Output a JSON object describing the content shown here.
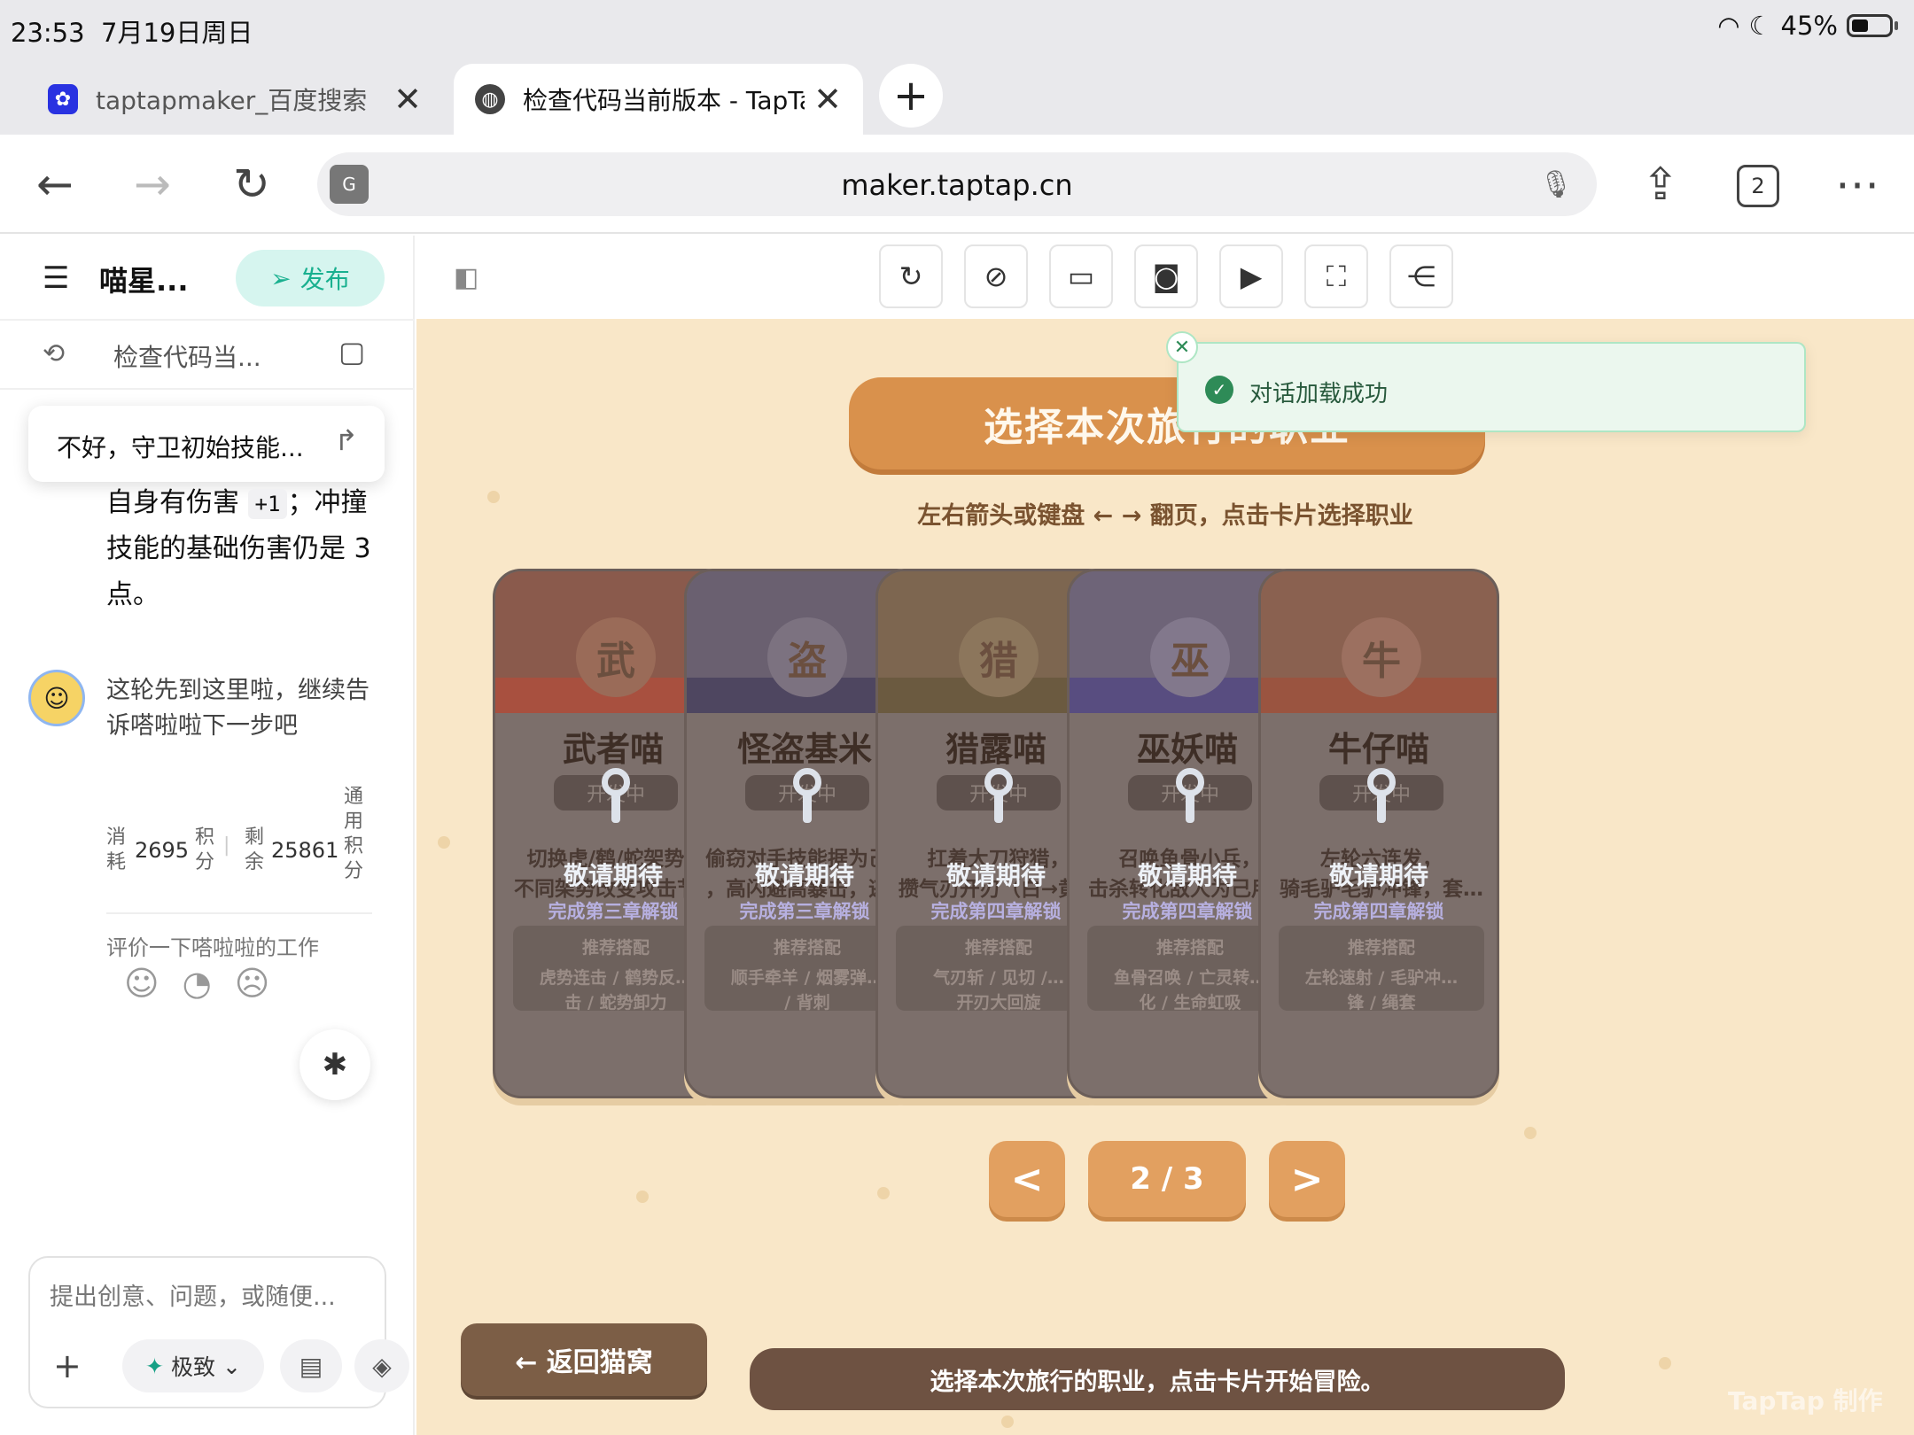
{
  "status": {
    "time": "23:53",
    "date": "7月19日周日",
    "battery": "45%"
  },
  "tabs": [
    {
      "title": "taptapmaker_百度搜索",
      "favicon": "baidu-icon"
    },
    {
      "title": "检查代码当前版本 - TapTa",
      "favicon": "globe-icon"
    }
  ],
  "address": {
    "url": "maker.taptap.cn",
    "tab_count": "2"
  },
  "sidebar": {
    "project_name": "喵星...",
    "publish_label": "发布",
    "session_title": "检查代码当...",
    "quote": "不好，守卫初始技能...",
    "msg_line1": "自身有伤害",
    "msg_chip": "+1",
    "msg_line2": "；冲撞技能的基础伤害仍是 3 点。",
    "bot_message": "这轮先到这里啦，继续告诉嗒啦啦下一步吧",
    "usage": {
      "consume_label": "消耗",
      "consume_value": "2695",
      "points_label": "积分",
      "remain_label": "剩余",
      "remain_value": "25861",
      "general_label": "通用积分"
    },
    "rate_label": "评价一下嗒啦啦的工作",
    "input_placeholder": "提出创意、问题，或随便...",
    "mode_label": "极致"
  },
  "game": {
    "title": "选择本次旅行的职业",
    "hint": "左右箭头或键盘 ← → 翻页，点击卡片选择职业",
    "cards": [
      {
        "badge": "武",
        "name": "武者喵",
        "chip": "开发中",
        "desc1": "切换虎/鹤/蛇架势，",
        "desc2": "不同架势改变攻击节…",
        "lock_msg": "敬请期待",
        "unlock": "完成第三章解锁",
        "rec_label": "推荐搭配",
        "rec": "虎势连击 / 鹤势反…\n击 / 蛇势卸力",
        "top": "#8a5a4c",
        "band": "#a8503f",
        "badge_bg": "#9a6b58"
      },
      {
        "badge": "盗",
        "name": "怪盗基米",
        "chip": "开发中",
        "desc1": "偷窃对手技能据为己用",
        "desc2": "，高闪避高暴击，逃…",
        "lock_msg": "敬请期待",
        "unlock": "完成第三章解锁",
        "rec_label": "推荐搭配",
        "rec": "顺手牵羊 / 烟雾弹…\n/ 背刺",
        "top": "#6a6070",
        "band": "#4e4660",
        "badge_bg": "#7c7280"
      },
      {
        "badge": "猎",
        "name": "猎露喵",
        "chip": "开发中",
        "desc1": "扛着大刀狩猎，",
        "desc2": "攒气刃开刃（白→黄…",
        "lock_msg": "敬请期待",
        "unlock": "完成第四章解锁",
        "rec_label": "推荐搭配",
        "rec": "气刃斩 / 见切 /…\n开刃大回旋",
        "top": "#7d6650",
        "band": "#6b5a40",
        "badge_bg": "#8c765c"
      },
      {
        "badge": "巫",
        "name": "巫妖喵",
        "chip": "开发中",
        "desc1": "召唤鱼骨小兵，",
        "desc2": "击杀转化敌人为己用…",
        "lock_msg": "敬请期待",
        "unlock": "完成第四章解锁",
        "rec_label": "推荐搭配",
        "rec": "鱼骨召唤 / 亡灵转…\n化 / 生命虹吸",
        "top": "#6e6478",
        "band": "#584d80",
        "badge_bg": "#82788c"
      },
      {
        "badge": "牛",
        "name": "牛仔喵",
        "chip": "开发中",
        "desc1": "左轮六连发，",
        "desc2": "骑毛驴毛驴冲锋，套…",
        "lock_msg": "敬请期待",
        "unlock": "完成第四章解锁",
        "rec_label": "推荐搭配",
        "rec": "左轮速射 / 毛驴冲…\n锋 / 绳套",
        "top": "#8a6150",
        "band": "#9a5440",
        "badge_bg": "#9c7060"
      }
    ],
    "prev": "<",
    "page": "2 / 3",
    "next": ">",
    "back_label": "← 返回猫窝",
    "footer": "选择本次旅行的职业，点击卡片开始冒险。",
    "watermark": "TapTap 制作"
  },
  "toast": {
    "text": "对话加载成功"
  }
}
